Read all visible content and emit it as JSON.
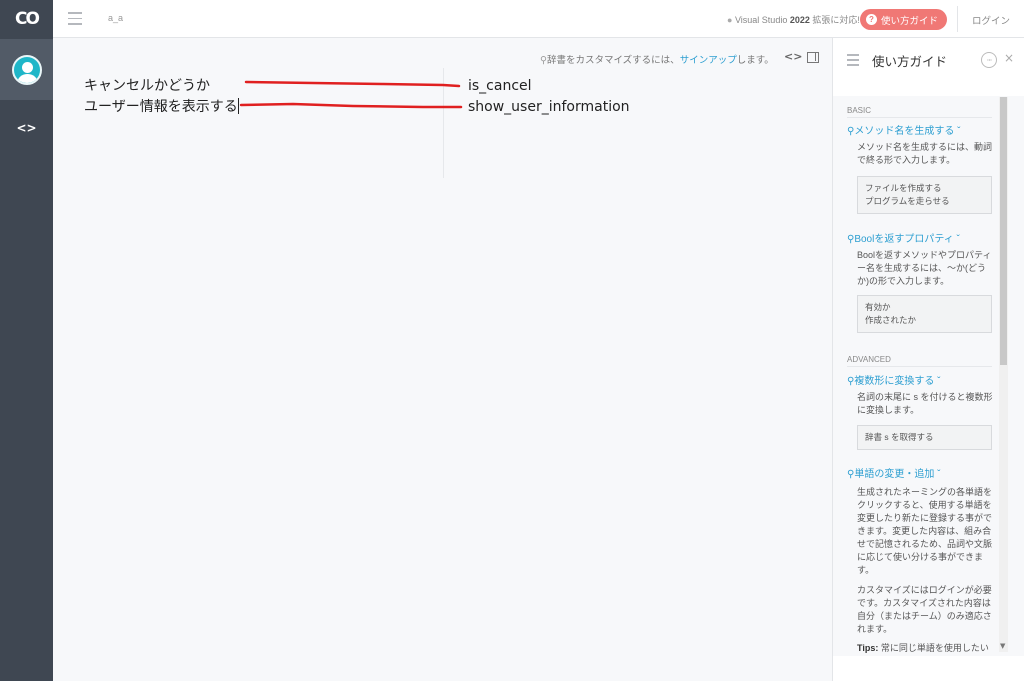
{
  "app": {
    "logo": "CO",
    "doc_name": "a_a"
  },
  "header": {
    "vs_prefix": "Visual Studio ",
    "vs_version": "2022",
    "vs_suffix": " 拡張に対応!",
    "guide_button": "使い方ガイド",
    "guide_button_icon": "?",
    "login": "ログイン"
  },
  "editor": {
    "dict_hint_prefix": "辞書をカスタマイズするには、",
    "dict_hint_link": "サインアップ",
    "dict_hint_suffix": "します。",
    "code_toggle": "<>",
    "input_lines": [
      "キャンセルかどうか",
      "ユーザー情報を表示する"
    ],
    "output_lines": [
      "is_cancel",
      "show_user_information"
    ],
    "annotation_color": "#e02020"
  },
  "sidebar": {
    "code_nav": "<>"
  },
  "guide": {
    "title": "使い方ガイド",
    "more": "···",
    "close": "×",
    "basic_label": "BASIC",
    "advanced_label": "ADVANCED",
    "topics": [
      {
        "title": "メソッド名を生成する",
        "desc": "メソッド名を生成するには、動詞で終る形で入力します。",
        "examples": [
          "ファイルを作成する",
          "プログラムを走らせる"
        ]
      },
      {
        "title": "Boolを返すプロパティ",
        "desc": "Boolを返すメソッドやプロパティー名を生成するには、〜か(どうか)の形で入力します。",
        "examples": [
          "有効か",
          "作成されたか"
        ]
      },
      {
        "title": "複数形に変換する",
        "desc": "名詞の末尾に s を付けると複数形に変換します。",
        "examples": [
          "辞書 s を取得する"
        ]
      },
      {
        "title": "単語の変更・追加",
        "desc": "生成されたネーミングの各単語をクリックすると、使用する単語を変更したり新たに登録する事ができます。変更した内容は、組み合せで記憶されるため、品詞や文脈に応じて使い分ける事ができます。",
        "desc2": "カスタマイズにはログインが必要です。カスタマイズされた内容は自分（またはチーム）のみ適応されます。",
        "tips_label": "Tips:",
        "tips_text": " 常に同じ単語を使用したい"
      }
    ]
  },
  "colors": {
    "accent": "#2e9fd1",
    "guide_button": "#f07875",
    "sidebar": "#3f4752"
  }
}
